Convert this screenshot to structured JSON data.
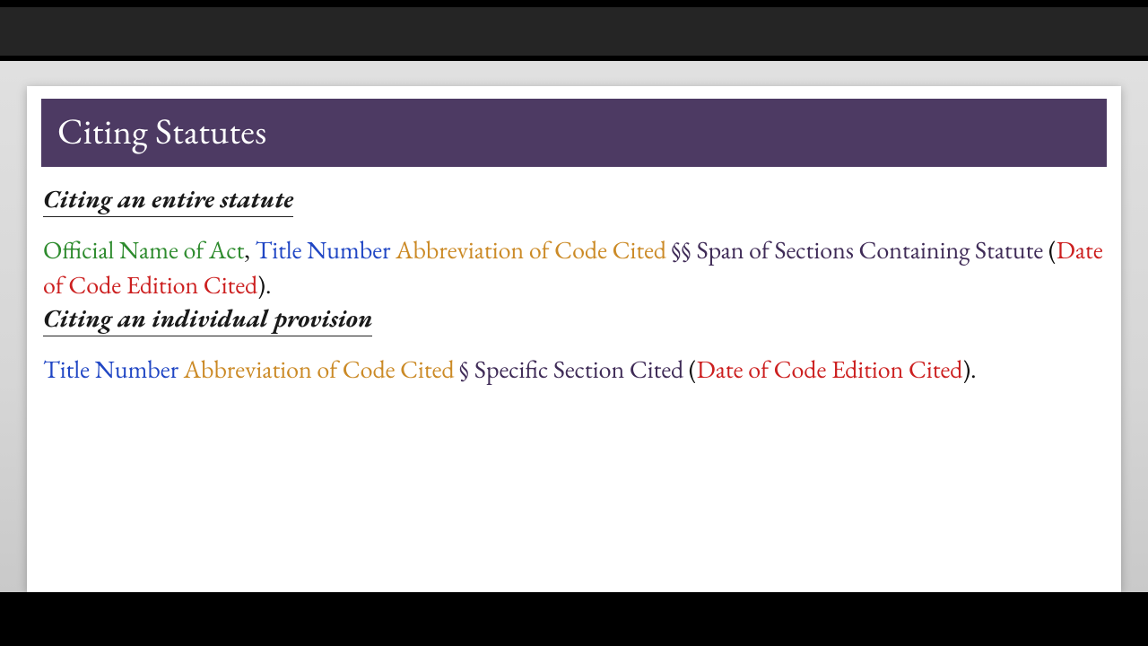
{
  "slide": {
    "title": "Citing Statutes",
    "section1": {
      "heading": "Citing an entire statute",
      "parts": {
        "official_name": "Official Name of Act",
        "comma1": ", ",
        "title_number": "Title Number",
        "space1": " ",
        "abbrev": "Abbreviation of Code Cited",
        "space2": " ",
        "sections_symbol": "§§ ",
        "span_sections": "Span of Sections Containing Statute",
        "space3": " ",
        "open_paren": "(",
        "date_edition": "Date of Code Edition Cited",
        "close_paren": ").",
        "period": ""
      }
    },
    "section2": {
      "heading": "Citing an individual provision",
      "parts": {
        "title_number": "Title Number",
        "space1": " ",
        "abbrev": "Abbreviation of Code Cited",
        "space2": " ",
        "section_symbol": "§ ",
        "specific_section": "Specific Section Cited",
        "space3": " ",
        "open_paren": "(",
        "date_edition": "Date of Code Edition Cited",
        "close_paren": ").",
        "period": ""
      }
    }
  }
}
